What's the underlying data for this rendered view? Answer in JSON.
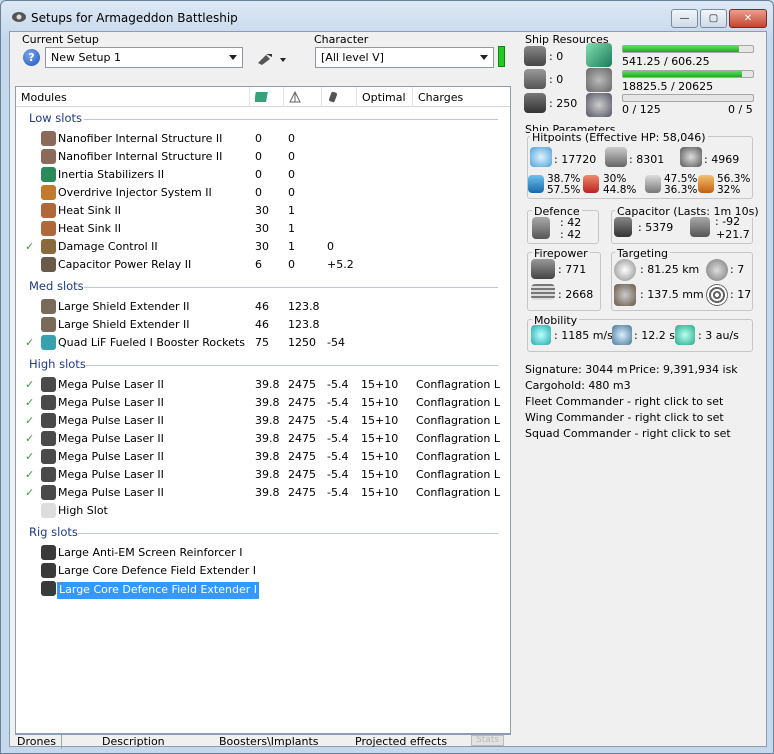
{
  "window": {
    "title": "Setups for Armageddon Battleship",
    "min": "—",
    "max": "▢",
    "close": "✕"
  },
  "setup": {
    "label": "Current Setup",
    "value": "New Setup 1"
  },
  "character": {
    "label": "Character",
    "value": "[All level V]"
  },
  "columns": {
    "modules": "Modules",
    "optimal": "Optimal",
    "charges": "Charges"
  },
  "sections": {
    "low": "Low slots",
    "med": "Med slots",
    "high": "High slots",
    "rig": "Rig slots"
  },
  "low": [
    {
      "name": "Nanofiber Internal Structure II",
      "cpu": "0",
      "pg": "0",
      "cap": "",
      "opt": "",
      "chg": "",
      "on": false,
      "icon": "#8b6a5a"
    },
    {
      "name": "Nanofiber Internal Structure II",
      "cpu": "0",
      "pg": "0",
      "cap": "",
      "opt": "",
      "chg": "",
      "on": false,
      "icon": "#8b6a5a"
    },
    {
      "name": "Inertia Stabilizers II",
      "cpu": "0",
      "pg": "0",
      "cap": "",
      "opt": "",
      "chg": "",
      "on": false,
      "icon": "#2b8a5a"
    },
    {
      "name": "Overdrive Injector System II",
      "cpu": "0",
      "pg": "0",
      "cap": "",
      "opt": "",
      "chg": "",
      "on": false,
      "icon": "#c27a2a"
    },
    {
      "name": "Heat Sink II",
      "cpu": "30",
      "pg": "1",
      "cap": "",
      "opt": "",
      "chg": "",
      "on": false,
      "icon": "#b0683a"
    },
    {
      "name": "Heat Sink II",
      "cpu": "30",
      "pg": "1",
      "cap": "",
      "opt": "",
      "chg": "",
      "on": false,
      "icon": "#b0683a"
    },
    {
      "name": "Damage Control II",
      "cpu": "30",
      "pg": "1",
      "cap": "0",
      "opt": "",
      "chg": "",
      "on": true,
      "icon": "#8a6a3a"
    },
    {
      "name": "Capacitor Power Relay II",
      "cpu": "6",
      "pg": "0",
      "cap": "+5.2",
      "opt": "",
      "chg": "",
      "on": false,
      "icon": "#6a5a4a"
    }
  ],
  "med": [
    {
      "name": "Large Shield Extender II",
      "cpu": "46",
      "pg": "123.8",
      "cap": "",
      "opt": "",
      "chg": "",
      "on": false,
      "icon": "#7a6a5a"
    },
    {
      "name": "Large Shield Extender II",
      "cpu": "46",
      "pg": "123.8",
      "cap": "",
      "opt": "",
      "chg": "",
      "on": false,
      "icon": "#7a6a5a"
    },
    {
      "name": "Quad LiF Fueled I Booster Rockets",
      "cpu": "75",
      "pg": "1250",
      "cap": "-54",
      "opt": "",
      "chg": "",
      "on": true,
      "icon": "#3aa0b0"
    }
  ],
  "high": [
    {
      "name": "Mega Pulse Laser II",
      "cpu": "39.8",
      "pg": "2475",
      "cap": "-5.4",
      "opt": "15+10",
      "chg": "Conflagration L",
      "on": true,
      "icon": "#4a4a4a"
    },
    {
      "name": "Mega Pulse Laser II",
      "cpu": "39.8",
      "pg": "2475",
      "cap": "-5.4",
      "opt": "15+10",
      "chg": "Conflagration L",
      "on": true,
      "icon": "#4a4a4a"
    },
    {
      "name": "Mega Pulse Laser II",
      "cpu": "39.8",
      "pg": "2475",
      "cap": "-5.4",
      "opt": "15+10",
      "chg": "Conflagration L",
      "on": true,
      "icon": "#4a4a4a"
    },
    {
      "name": "Mega Pulse Laser II",
      "cpu": "39.8",
      "pg": "2475",
      "cap": "-5.4",
      "opt": "15+10",
      "chg": "Conflagration L",
      "on": true,
      "icon": "#4a4a4a"
    },
    {
      "name": "Mega Pulse Laser II",
      "cpu": "39.8",
      "pg": "2475",
      "cap": "-5.4",
      "opt": "15+10",
      "chg": "Conflagration L",
      "on": true,
      "icon": "#4a4a4a"
    },
    {
      "name": "Mega Pulse Laser II",
      "cpu": "39.8",
      "pg": "2475",
      "cap": "-5.4",
      "opt": "15+10",
      "chg": "Conflagration L",
      "on": true,
      "icon": "#4a4a4a"
    },
    {
      "name": "Mega Pulse Laser II",
      "cpu": "39.8",
      "pg": "2475",
      "cap": "-5.4",
      "opt": "15+10",
      "chg": "Conflagration L",
      "on": true,
      "icon": "#4a4a4a"
    },
    {
      "name": "High Slot",
      "cpu": "",
      "pg": "",
      "cap": "",
      "opt": "",
      "chg": "",
      "on": false,
      "icon": "#dddddd"
    }
  ],
  "rig": [
    {
      "name": "Large Anti-EM Screen Reinforcer I",
      "icon": "#3a3a3a"
    },
    {
      "name": "Large Core Defence Field Extender I",
      "icon": "#3a3a3a"
    },
    {
      "name": "Large Core Defence Field Extender I",
      "icon": "#3a3a3a",
      "selected": true
    }
  ],
  "tabs": [
    "Drones",
    "Description",
    "Boosters\\Implants",
    "Projected effects",
    "Stats"
  ],
  "resources": {
    "title": "Ship Resources",
    "turrets": ": 0",
    "launchers": ": 0",
    "calibration": ": 250",
    "cpu_text": "541.25 / 606.25",
    "cpu_fill": 0.893,
    "pg_text": "18825.5 / 20625",
    "pg_fill": 0.913,
    "drone_text": "0 / 125",
    "drone_fill": 0,
    "drone_bw": "0 / 5"
  },
  "params": {
    "title": "Ship Parameters",
    "hp_title": "Hitpoints (Effective HP: 58,046)",
    "shield": ": 17720",
    "armor": ": 8301",
    "hull": ": 4969",
    "em": [
      "38.7%",
      "57.5%"
    ],
    "th": [
      "30%",
      "44.8%"
    ],
    "ki": [
      "47.5%",
      "36.3%"
    ],
    "ex": [
      "56.3%",
      "32%"
    ],
    "def_title": "Defence",
    "def1": ": 42",
    "def2": ": 42",
    "cap_title": "Capacitor (Lasts: 1m 10s)",
    "cap_amt": ": 5379",
    "cap_d1": ": -92",
    "cap_d2": "+21.7",
    "fp_title": "Firepower",
    "dps": ": 771",
    "volley": ": 2668",
    "tg_title": "Targeting",
    "range": ": 81.25 km",
    "targets": ": 7",
    "scan": ": 137.5 mm",
    "sens": ": 17",
    "mob_title": "Mobility",
    "speed": ": 1185 m/s",
    "align": ": 12.2 s",
    "warp": ": 3 au/s"
  },
  "misc": {
    "signature": "Signature: 3044 m",
    "price": "Price: 9,391,934 isk",
    "cargo": "Cargohold: 480 m3",
    "fleet": "Fleet Commander - right click to set",
    "wing": "Wing Commander - right click to set",
    "squad": "Squad Commander - right click to set"
  }
}
